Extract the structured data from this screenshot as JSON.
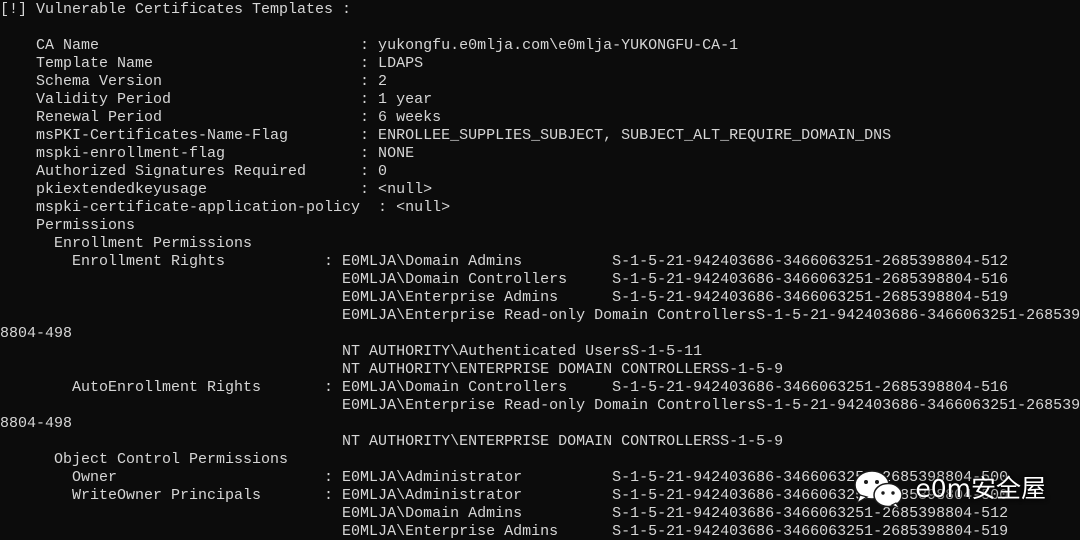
{
  "terminal": {
    "lines": [
      "[!] Vulnerable Certificates Templates :",
      "",
      "    CA Name                             : yukongfu.e0mlja.com\\e0mlja-YUKONGFU-CA-1",
      "    Template Name                       : LDAPS",
      "    Schema Version                      : 2",
      "    Validity Period                     : 1 year",
      "    Renewal Period                      : 6 weeks",
      "    msPKI-Certificates-Name-Flag        : ENROLLEE_SUPPLIES_SUBJECT, SUBJECT_ALT_REQUIRE_DOMAIN_DNS",
      "    mspki-enrollment-flag               : NONE",
      "    Authorized Signatures Required      : 0",
      "    pkiextendedkeyusage                 : <null>",
      "    mspki-certificate-application-policy  : <null>",
      "    Permissions",
      "      Enrollment Permissions",
      "        Enrollment Rights           : E0MLJA\\Domain Admins          S-1-5-21-942403686-3466063251-2685398804-512",
      "                                      E0MLJA\\Domain Controllers     S-1-5-21-942403686-3466063251-2685398804-516",
      "                                      E0MLJA\\Enterprise Admins      S-1-5-21-942403686-3466063251-2685398804-519",
      "                                      E0MLJA\\Enterprise Read-only Domain ControllersS-1-5-21-942403686-3466063251-268539",
      "8804-498",
      "                                      NT AUTHORITY\\Authenticated UsersS-1-5-11",
      "                                      NT AUTHORITY\\ENTERPRISE DOMAIN CONTROLLERSS-1-5-9",
      "        AutoEnrollment Rights       : E0MLJA\\Domain Controllers     S-1-5-21-942403686-3466063251-2685398804-516",
      "                                      E0MLJA\\Enterprise Read-only Domain ControllersS-1-5-21-942403686-3466063251-268539",
      "8804-498",
      "                                      NT AUTHORITY\\ENTERPRISE DOMAIN CONTROLLERSS-1-5-9",
      "      Object Control Permissions",
      "        Owner                       : E0MLJA\\Administrator          S-1-5-21-942403686-3466063251-2685398804-500",
      "        WriteOwner Principals       : E0MLJA\\Administrator          S-1-5-21-942403686-3466063251-2685398804-500",
      "                                      E0MLJA\\Domain Admins          S-1-5-21-942403686-3466063251-2685398804-512",
      "                                      E0MLJA\\Enterprise Admins      S-1-5-21-942403686-3466063251-2685398804-519"
    ]
  },
  "watermark": {
    "text": "e0m安全屋",
    "icon": "wechat-icon"
  },
  "colors": {
    "background": "#0c0c0c",
    "foreground": "#d6d6d6"
  }
}
